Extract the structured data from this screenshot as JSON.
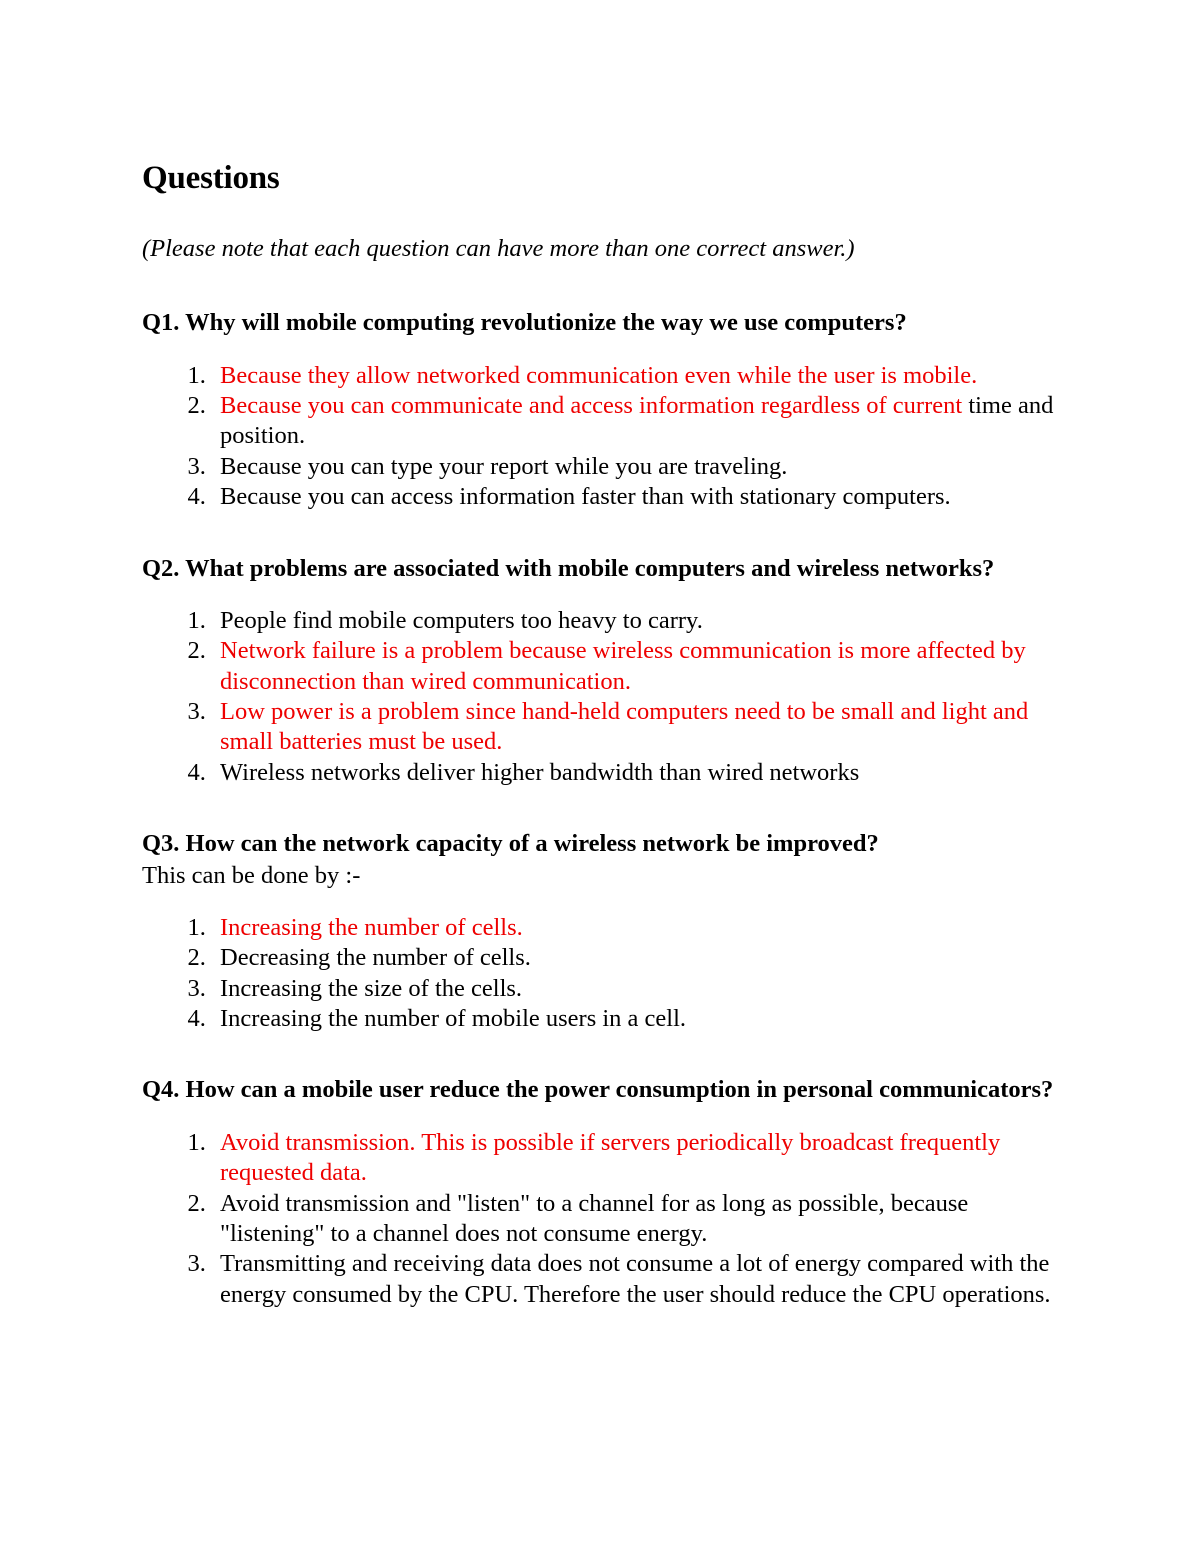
{
  "document": {
    "title": "Questions",
    "note": "(Please note that each question can have more than one correct answer.)",
    "colors": {
      "correct_answer": "#ee0000",
      "text": "#000000",
      "page_background": "#ffffff"
    },
    "questions": [
      {
        "id": "q1",
        "heading": "Q1. Why will mobile computing revolutionize the way we use computers?",
        "subline": "",
        "answers": [
          {
            "number": "1.",
            "correct": true,
            "parts": [
              {
                "text": "Because they allow networked communication even while the user is mobile.",
                "color": "red"
              }
            ]
          },
          {
            "number": "2.",
            "correct": true,
            "parts": [
              {
                "text": "Because you can communicate and access information regardless of current ",
                "color": "red"
              },
              {
                "text": "time and position.",
                "color": "black"
              }
            ]
          },
          {
            "number": "3.",
            "correct": false,
            "parts": [
              {
                "text": "Because you can type your report while you are traveling.",
                "color": "black"
              }
            ]
          },
          {
            "number": "4.",
            "correct": false,
            "parts": [
              {
                "text": "Because you can access information faster than with stationary computers.",
                "color": "black"
              }
            ]
          }
        ]
      },
      {
        "id": "q2",
        "heading": "Q2. What problems are associated with mobile computers and wireless networks?",
        "subline": "",
        "answers": [
          {
            "number": "1.",
            "correct": false,
            "parts": [
              {
                "text": "People find mobile computers too heavy to carry.",
                "color": "black"
              }
            ]
          },
          {
            "number": "2.",
            "correct": true,
            "parts": [
              {
                "text": "Network failure is a problem because wireless communication is more affected by disconnection than wired communication.",
                "color": "red"
              }
            ]
          },
          {
            "number": "3.",
            "correct": true,
            "parts": [
              {
                "text": "Low power is a problem since hand-held computers need to be small and light and small batteries must be used.",
                "color": "red"
              }
            ]
          },
          {
            "number": "4.",
            "correct": false,
            "parts": [
              {
                "text": "Wireless networks deliver higher bandwidth than wired networks",
                "color": "black"
              }
            ]
          }
        ]
      },
      {
        "id": "q3",
        "heading": "Q3. How can the network capacity of a wireless network be improved?",
        "subline": "This can be done by :-",
        "answers": [
          {
            "number": "1.",
            "correct": true,
            "parts": [
              {
                "text": "Increasing the number of cells.",
                "color": "red"
              }
            ]
          },
          {
            "number": "2.",
            "correct": false,
            "parts": [
              {
                "text": "Decreasing the number of cells.",
                "color": "black"
              }
            ]
          },
          {
            "number": "3.",
            "correct": false,
            "parts": [
              {
                "text": "Increasing the size of the cells.",
                "color": "black"
              }
            ]
          },
          {
            "number": "4.",
            "correct": false,
            "parts": [
              {
                "text": "Increasing the number of mobile users in a cell.",
                "color": "black"
              }
            ]
          }
        ]
      },
      {
        "id": "q4",
        "heading": "Q4. How can a mobile user reduce the power consumption in personal communicators?",
        "subline": "",
        "answers": [
          {
            "number": "1.",
            "correct": true,
            "parts": [
              {
                "text": "Avoid transmission. This is possible if servers periodically broadcast frequently requested data.",
                "color": "red"
              }
            ]
          },
          {
            "number": "2.",
            "correct": false,
            "parts": [
              {
                "text": "Avoid transmission and \"listen\" to a channel for as long as possible, because \"listening\" to a channel does not consume energy.",
                "color": "black"
              }
            ]
          },
          {
            "number": "3.",
            "correct": false,
            "parts": [
              {
                "text": "Transmitting and receiving data does not consume a lot of energy compared with the energy consumed by the CPU. Therefore the user should reduce the CPU operations.",
                "color": "black"
              }
            ]
          }
        ]
      }
    ]
  }
}
